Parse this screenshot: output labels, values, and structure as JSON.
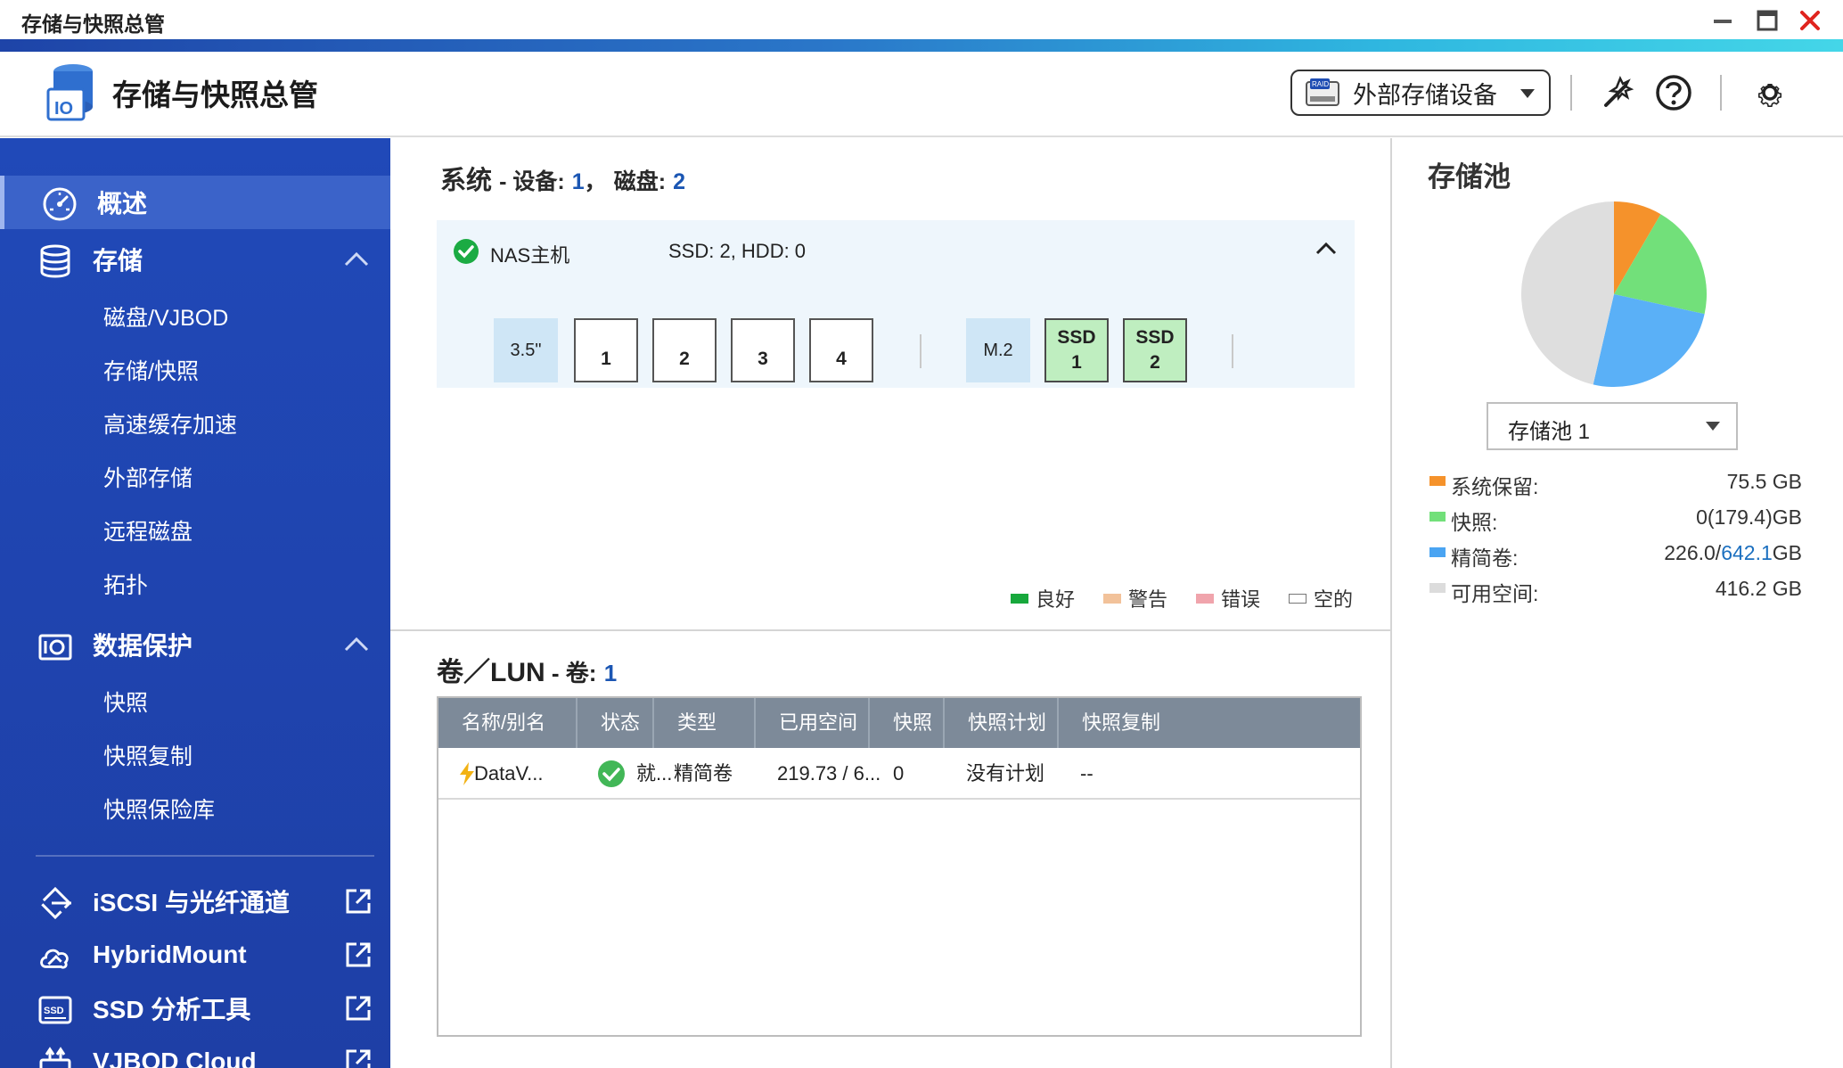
{
  "window": {
    "title": "存储与快照总管"
  },
  "header": {
    "app_title": "存储与快照总管",
    "external_storage_button": "外部存储设备"
  },
  "sidebar": {
    "overview": "概述",
    "storage": "存储",
    "storage_items": [
      "磁盘/VJBOD",
      "存储/快照",
      "高速缓存加速",
      "外部存储",
      "远程磁盘",
      "拓扑"
    ],
    "data_protection": "数据保护",
    "protection_items": [
      "快照",
      "快照复制",
      "快照保险库"
    ],
    "iscsi": "iSCSI 与光纤通道",
    "hybridmount": "HybridMount",
    "ssd_tool": "SSD 分析工具",
    "vjbod_cloud": "VJBOD Cloud"
  },
  "system": {
    "title": "系统",
    "devices_label": "设备:",
    "devices_count": "1",
    "disks_label": "磁盘:",
    "disks_count": "2",
    "device_name": "NAS主机",
    "device_summary": "SSD: 2, HDD: 0",
    "bay_label_35": "3.5\"",
    "bays": [
      "1",
      "2",
      "3",
      "4"
    ],
    "bay_label_m2": "M.2",
    "ssd_slots": [
      {
        "top": "SSD",
        "num": "1"
      },
      {
        "top": "SSD",
        "num": "2"
      }
    ]
  },
  "legend": [
    {
      "label": "良好",
      "color": "#17a83c"
    },
    {
      "label": "警告",
      "color": "#f2c29a"
    },
    {
      "label": "错误",
      "color": "#f0a4ac"
    },
    {
      "label": "空的",
      "color": "#ffffff"
    }
  ],
  "volumes": {
    "title": "卷／LUN",
    "count_label": "卷:",
    "count": "1",
    "columns": [
      "名称/别名",
      "状态",
      "类型",
      "已用空间",
      "快照",
      "快照计划",
      "快照复制"
    ],
    "rows": [
      {
        "name": "DataV...",
        "status": "就...",
        "type": "精简卷",
        "used": "219.73 / 6...",
        "snapshots": "0",
        "schedule": "没有计划",
        "replication": "--"
      }
    ]
  },
  "pool": {
    "title": "存储池",
    "selected": "存储池 1",
    "stats": [
      {
        "label": "系统保留:",
        "value": "75.5 GB",
        "color": "#f5922b"
      },
      {
        "label": "快照:",
        "value": "0(179.4)GB",
        "color": "#72e07a"
      },
      {
        "label": "精简卷:",
        "value_prefix": "226.0/",
        "value_highlight": "642.1",
        "value_suffix": "GB",
        "color": "#4aa4f2"
      },
      {
        "label": "可用空间:",
        "value": "416.2 GB",
        "color": "#dcdcdc"
      }
    ],
    "chart_data": {
      "type": "pie",
      "slices": [
        {
          "name": "系统保留",
          "value": 75.5,
          "color": "#f5922b"
        },
        {
          "name": "快照",
          "value": 179.4,
          "color": "#72e07a"
        },
        {
          "name": "精简卷",
          "value": 226.0,
          "color": "#5ab0f7"
        },
        {
          "name": "可用空间",
          "value": 416.2,
          "color": "#dedede"
        }
      ]
    }
  }
}
